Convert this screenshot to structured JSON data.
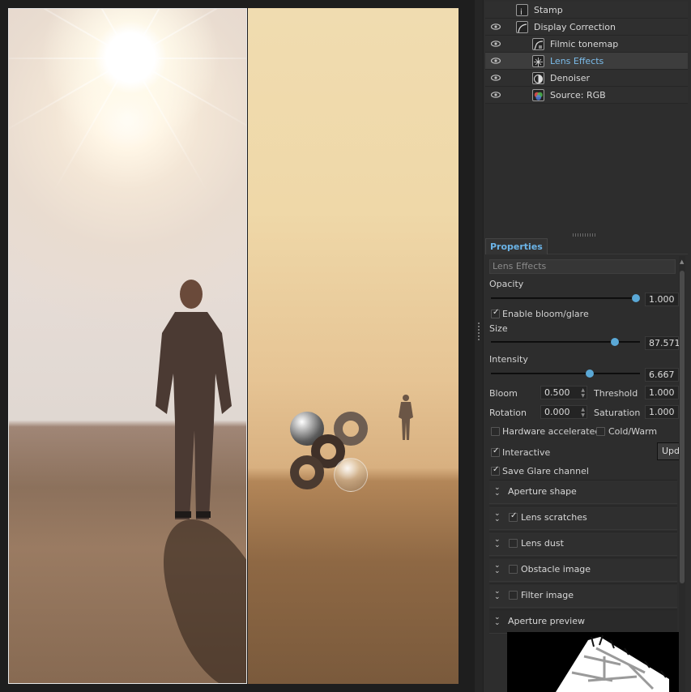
{
  "layers": [
    {
      "label": "Stamp",
      "icon": "stamp-icon",
      "visible": false,
      "indent": 0
    },
    {
      "label": "Display Correction",
      "icon": "curve-icon",
      "visible": true,
      "indent": 0
    },
    {
      "label": "Filmic tonemap",
      "icon": "tonemap-icon",
      "visible": true,
      "indent": 1
    },
    {
      "label": "Lens Effects",
      "icon": "lens-effects-icon",
      "visible": true,
      "indent": 1,
      "selected": true
    },
    {
      "label": "Denoiser",
      "icon": "denoiser-icon",
      "visible": true,
      "indent": 1
    },
    {
      "label": "Source: RGB",
      "icon": "rgb-source-icon",
      "visible": true,
      "indent": 1
    }
  ],
  "properties": {
    "tab_label": "Properties",
    "effect_name": "Lens Effects",
    "opacity_label": "Opacity",
    "opacity_value": "1.000",
    "opacity_fraction": 1.0,
    "enable_bloom_label": "Enable bloom/glare",
    "enable_bloom_checked": true,
    "size_label": "Size",
    "size_value": "87.571",
    "size_fraction": 0.85,
    "intensity_label": "Intensity",
    "intensity_value": "6.667",
    "intensity_fraction": 0.67,
    "bloom_label": "Bloom",
    "bloom_value": "0.500",
    "threshold_label": "Threshold",
    "threshold_value": "1.000",
    "rotation_label": "Rotation",
    "rotation_value": "0.000",
    "saturation_label": "Saturation",
    "saturation_value": "1.000",
    "hardware_label": "Hardware accelerated",
    "hardware_checked": false,
    "coldwarm_label": "Cold/Warm",
    "coldwarm_checked": false,
    "interactive_label": "Interactive",
    "interactive_checked": true,
    "update_button_label": "Upd",
    "save_glare_label": "Save Glare channel",
    "save_glare_checked": true,
    "sections": [
      {
        "label": "Aperture shape",
        "has_check": false,
        "checked": false
      },
      {
        "label": "Lens scratches",
        "has_check": true,
        "checked": true
      },
      {
        "label": "Lens dust",
        "has_check": true,
        "checked": false
      },
      {
        "label": "Obstacle image",
        "has_check": true,
        "checked": false
      },
      {
        "label": "Filter image",
        "has_check": true,
        "checked": false
      },
      {
        "label": "Aperture preview",
        "has_check": false,
        "checked": false
      }
    ]
  },
  "colors": {
    "accent": "#5aa8d6",
    "selected_text": "#7bbcea"
  }
}
